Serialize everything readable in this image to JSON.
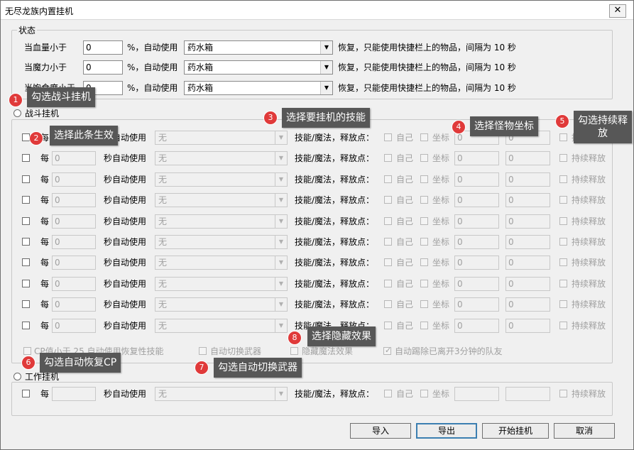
{
  "window": {
    "title": "无尽龙族内置挂机",
    "close_glyph": "✕"
  },
  "status": {
    "legend": "状态",
    "rows": [
      {
        "label": "当血量小于",
        "value": "0",
        "pct": "%，自动使用",
        "item": "药水箱",
        "desc": "恢复，只能使用快捷栏上的物品，间隔为 10 秒"
      },
      {
        "label": "当魔力小于",
        "value": "0",
        "pct": "%，自动使用",
        "item": "药水箱",
        "desc": "恢复，只能使用快捷栏上的物品，间隔为 10 秒"
      },
      {
        "label": "当饱食度小于",
        "value": "0",
        "pct": "%，自动使用",
        "item": "药水箱",
        "desc": "恢复，只能使用快捷栏上的物品，间隔为 10 秒"
      }
    ]
  },
  "combat": {
    "radio_label": "战斗挂机",
    "row": {
      "every": "每",
      "interval": "0",
      "sec_auto": "秒自动使用",
      "skill": "无",
      "skill_label": "技能/魔法，释放点：",
      "self": "自己",
      "coord": "坐标",
      "x": "0",
      "y": "0",
      "continuous": "持续释放"
    },
    "rows_count": 10,
    "options": {
      "cp": "CP值小于 25 自动使用恢复性技能",
      "switch_weapon": "自动切换武器",
      "hide_effect": "隐藏魔法效果",
      "kick": "自动踢除已离开3分钟的队友"
    }
  },
  "work": {
    "radio_label": "工作挂机",
    "row": {
      "every": "每",
      "interval": "",
      "sec_auto": "秒自动使用",
      "skill": "无",
      "skill_label": "技能/魔法，释放点：",
      "self": "自己",
      "coord": "坐标",
      "x": "",
      "y": "",
      "continuous": "持续释放"
    }
  },
  "buttons": {
    "import": "导入",
    "export": "导出",
    "start": "开始挂机",
    "cancel": "取消"
  },
  "callouts": [
    {
      "num": "1",
      "text": "勾选战斗挂机"
    },
    {
      "num": "2",
      "text": "选择此条生效"
    },
    {
      "num": "3",
      "text": "选择要挂机的技能"
    },
    {
      "num": "4",
      "text": "选择怪物坐标"
    },
    {
      "num": "5",
      "text": "勾选持续释放"
    },
    {
      "num": "6",
      "text": "勾选自动恢复CP"
    },
    {
      "num": "7",
      "text": "勾选自动切换武器"
    },
    {
      "num": "8",
      "text": "选择隐藏效果"
    }
  ],
  "colors": {
    "callout_bg": "#575757",
    "badge": "#e03a3a",
    "default_button_border": "#3c7fb1"
  }
}
